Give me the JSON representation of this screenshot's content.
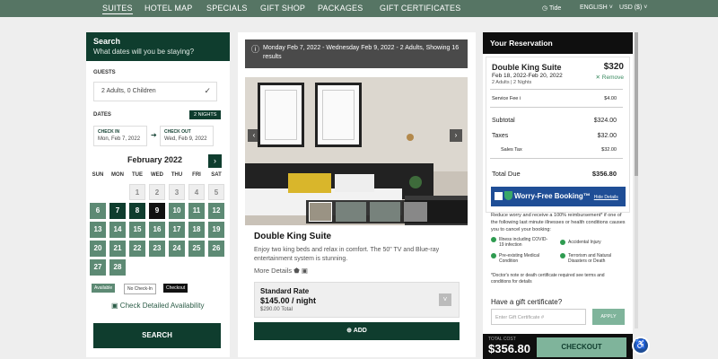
{
  "nav": {
    "items": [
      "SUITES",
      "HOTEL MAP",
      "SPECIALS",
      "GIFT SHOP",
      "PACKAGES",
      "GIFT CERTIFICATES"
    ],
    "active_index": 0,
    "tide_label": "Tide",
    "language": "ENGLISH",
    "currency": "USD ($)"
  },
  "search": {
    "title": "Search",
    "subtitle": "What dates will you be staying?",
    "guests_label": "GUESTS",
    "guests_value": "2 Adults, 0 Children",
    "dates_label": "DATES",
    "nights_badge": "2 NIGHTS",
    "checkin_label": "CHECK IN",
    "checkin_value": "Mon, Feb 7, 2022",
    "checkout_label": "CHECK OUT",
    "checkout_value": "Wed, Feb 9, 2022",
    "calendar_month": "February 2022",
    "weekdays": [
      "SUN",
      "MON",
      "TUE",
      "WED",
      "THU",
      "FRI",
      "SAT"
    ],
    "legend_available": "Available",
    "legend_no_checkin": "No Check-In",
    "legend_checkout": "Checkout",
    "check_availability": "Check Detailed Availability",
    "search_button": "SEARCH"
  },
  "calendar_days": [
    {
      "d": "",
      "s": "empty"
    },
    {
      "d": "",
      "s": "empty"
    },
    {
      "d": "1",
      "s": "past"
    },
    {
      "d": "2",
      "s": "past"
    },
    {
      "d": "3",
      "s": "past"
    },
    {
      "d": "4",
      "s": "past"
    },
    {
      "d": "5",
      "s": "past"
    },
    {
      "d": "6",
      "s": "avail"
    },
    {
      "d": "7",
      "s": "sel"
    },
    {
      "d": "8",
      "s": "sel"
    },
    {
      "d": "9",
      "s": "checkout"
    },
    {
      "d": "10",
      "s": "avail"
    },
    {
      "d": "11",
      "s": "avail"
    },
    {
      "d": "12",
      "s": "avail"
    },
    {
      "d": "13",
      "s": "avail"
    },
    {
      "d": "14",
      "s": "avail"
    },
    {
      "d": "15",
      "s": "avail"
    },
    {
      "d": "16",
      "s": "avail"
    },
    {
      "d": "17",
      "s": "avail"
    },
    {
      "d": "18",
      "s": "avail"
    },
    {
      "d": "19",
      "s": "avail"
    },
    {
      "d": "20",
      "s": "avail"
    },
    {
      "d": "21",
      "s": "avail"
    },
    {
      "d": "22",
      "s": "avail"
    },
    {
      "d": "23",
      "s": "avail"
    },
    {
      "d": "24",
      "s": "avail"
    },
    {
      "d": "25",
      "s": "avail"
    },
    {
      "d": "26",
      "s": "avail"
    },
    {
      "d": "27",
      "s": "avail"
    },
    {
      "d": "28",
      "s": "avail"
    }
  ],
  "room": {
    "stay_summary": "Monday Feb 7, 2022 - Wednesday Feb 9, 2022 - 2 Adults, Showing 16 results",
    "name": "Double King Suite",
    "description": "Enjoy two king beds and relax in comfort. The 50\" TV and Blue-ray entertainment system is stunning.",
    "more_details": "More Details",
    "rate_name": "Standard Rate",
    "rate_price": "$145.00 / night",
    "rate_total": "$290.00 Total",
    "add_button": "ADD"
  },
  "reservation": {
    "header": "Your Reservation",
    "room_name": "Double King Suite",
    "room_price": "$320",
    "room_dates": "Feb 18, 2022-Feb 20, 2022",
    "room_guests": "2 Adults | 2 Nights",
    "remove": "✕ Remove",
    "service_fee_label": "Service Fee i",
    "service_fee": "$4.00",
    "subtotal_label": "Subtotal",
    "subtotal": "$324.00",
    "taxes_label": "Taxes",
    "taxes": "$32.00",
    "sales_tax_label": "Sales Tax",
    "sales_tax": "$32.00",
    "total_due_label": "Total Due",
    "total_due": "$356.80",
    "worry_free": "Worry-Free Booking™",
    "hide_details": "Hide Details",
    "insurance_text": "Reduce worry and receive a 100% reimbursement* if one of the following last minute illnesses or health conditions causes you to cancel your booking:",
    "coverage": [
      "Illness including COVID-19 infection",
      "Accidental Injury",
      "Pre-existing Medical Condition",
      "Terrorism and Natural Disasters or Death"
    ],
    "insurance_note": "*Doctor's note or death certificate required see terms and conditions for details",
    "gift_question": "Have a gift certificate?",
    "gift_placeholder": "Enter Gift Certificate #",
    "apply": "APPLY",
    "total_label": "TOTAL COST",
    "total_value": "$356.80",
    "checkout_button": "CHECKOUT"
  }
}
